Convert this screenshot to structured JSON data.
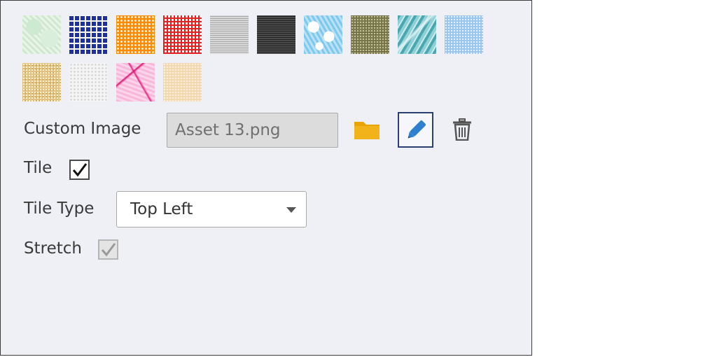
{
  "textures": [
    {
      "name": "green-marble",
      "class": "t-green-marble"
    },
    {
      "name": "blue-grid",
      "class": "t-blue-grid"
    },
    {
      "name": "orange-dots",
      "class": "t-orange-dots"
    },
    {
      "name": "red-plaid",
      "class": "t-red-plaid"
    },
    {
      "name": "gray-lines",
      "class": "t-gray-lines"
    },
    {
      "name": "dark-lines",
      "class": "t-dark-lines"
    },
    {
      "name": "blue-crackle",
      "class": "t-blue-crackle"
    },
    {
      "name": "olive-noise",
      "class": "t-olive-noise"
    },
    {
      "name": "teal-marble",
      "class": "t-teal-marble"
    },
    {
      "name": "blue-speckle",
      "class": "t-blue-speckle"
    },
    {
      "name": "gold-speckle",
      "class": "t-gold-speckle"
    },
    {
      "name": "white-speckle",
      "class": "t-white-speckle"
    },
    {
      "name": "pink-marble",
      "class": "t-pink-marble"
    },
    {
      "name": "peach-speckle",
      "class": "t-peach-speckle"
    }
  ],
  "custom_image": {
    "label": "Custom Image",
    "value": "Asset 13.png",
    "browse_icon": "folder-icon",
    "edit_icon": "pencil-icon",
    "delete_icon": "trash-icon"
  },
  "tile": {
    "label": "Tile",
    "checked": true
  },
  "tile_type": {
    "label": "Tile Type",
    "selected": "Top Left",
    "dropdown_icon": "chevron-down-icon"
  },
  "stretch": {
    "label": "Stretch",
    "checked": true,
    "enabled": false
  },
  "colors": {
    "panel_bg": "#eff0f5",
    "folder": "#e8a400",
    "pencil": "#2f7fd0",
    "edit_border": "#2b3f73"
  }
}
